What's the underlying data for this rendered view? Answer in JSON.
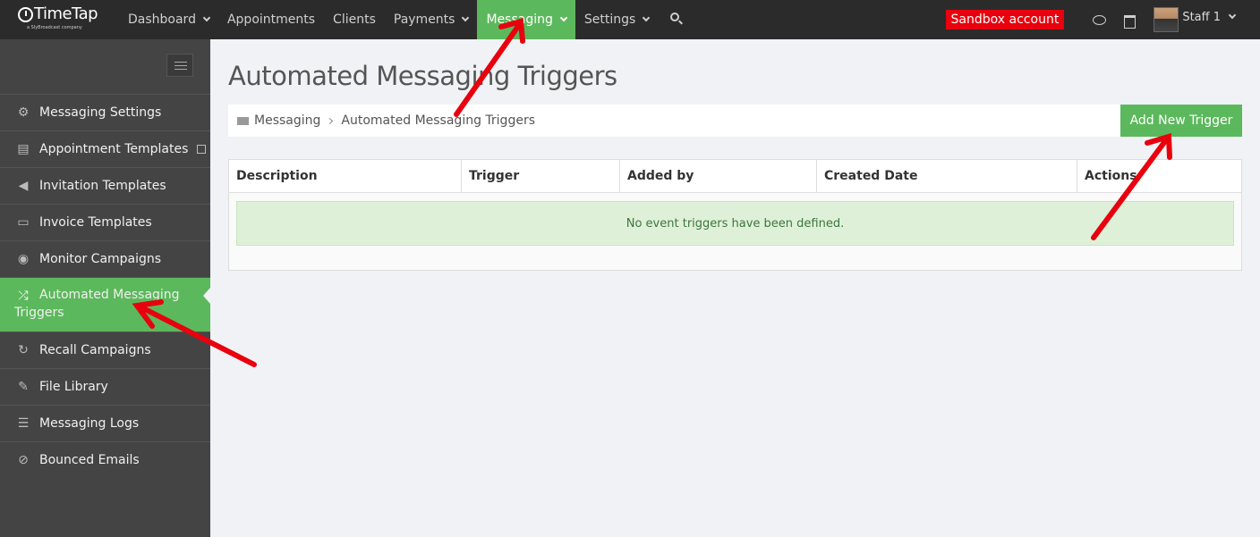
{
  "topnav": {
    "logo_text": "TimeTap",
    "logo_sub": "a SlyBroadcast company",
    "items": [
      {
        "label": "Dashboard",
        "dropdown": true
      },
      {
        "label": "Appointments",
        "dropdown": false
      },
      {
        "label": "Clients",
        "dropdown": false
      },
      {
        "label": "Payments",
        "dropdown": true
      },
      {
        "label": "Messaging",
        "dropdown": true,
        "active": true
      },
      {
        "label": "Settings",
        "dropdown": true
      }
    ],
    "sandbox_label": "Sandbox account",
    "user_label": "Staff 1"
  },
  "sidebar": {
    "items": [
      {
        "label": "Messaging Settings",
        "icon": "cogs-icon"
      },
      {
        "label": "Appointment Templates",
        "icon": "book-icon"
      },
      {
        "label": "Invitation Templates",
        "icon": "bullhorn-icon"
      },
      {
        "label": "Invoice Templates",
        "icon": "credit-card-icon"
      },
      {
        "label": "Monitor Campaigns",
        "icon": "eye-icon"
      },
      {
        "label": "Automated Messaging Triggers",
        "icon": "shuffle-icon",
        "active": true
      },
      {
        "label": "Recall Campaigns",
        "icon": "refresh-icon"
      },
      {
        "label": "File Library",
        "icon": "paperclip-icon"
      },
      {
        "label": "Messaging Logs",
        "icon": "list-icon"
      },
      {
        "label": "Bounced Emails",
        "icon": "ban-icon"
      }
    ]
  },
  "main": {
    "title": "Automated Messaging Triggers",
    "breadcrumb": [
      "Messaging",
      "Automated Messaging Triggers"
    ],
    "add_button_label": "Add New Trigger",
    "table": {
      "columns": [
        "Description",
        "Trigger",
        "Added by",
        "Created Date",
        "Actions"
      ],
      "empty_message": "No event triggers have been defined."
    }
  },
  "colors": {
    "accent": "#5cb85c",
    "topbar": "#2b2b2b",
    "sidebar": "#444444",
    "sandbox": "#e8000e",
    "annotation": "#e8000e"
  }
}
